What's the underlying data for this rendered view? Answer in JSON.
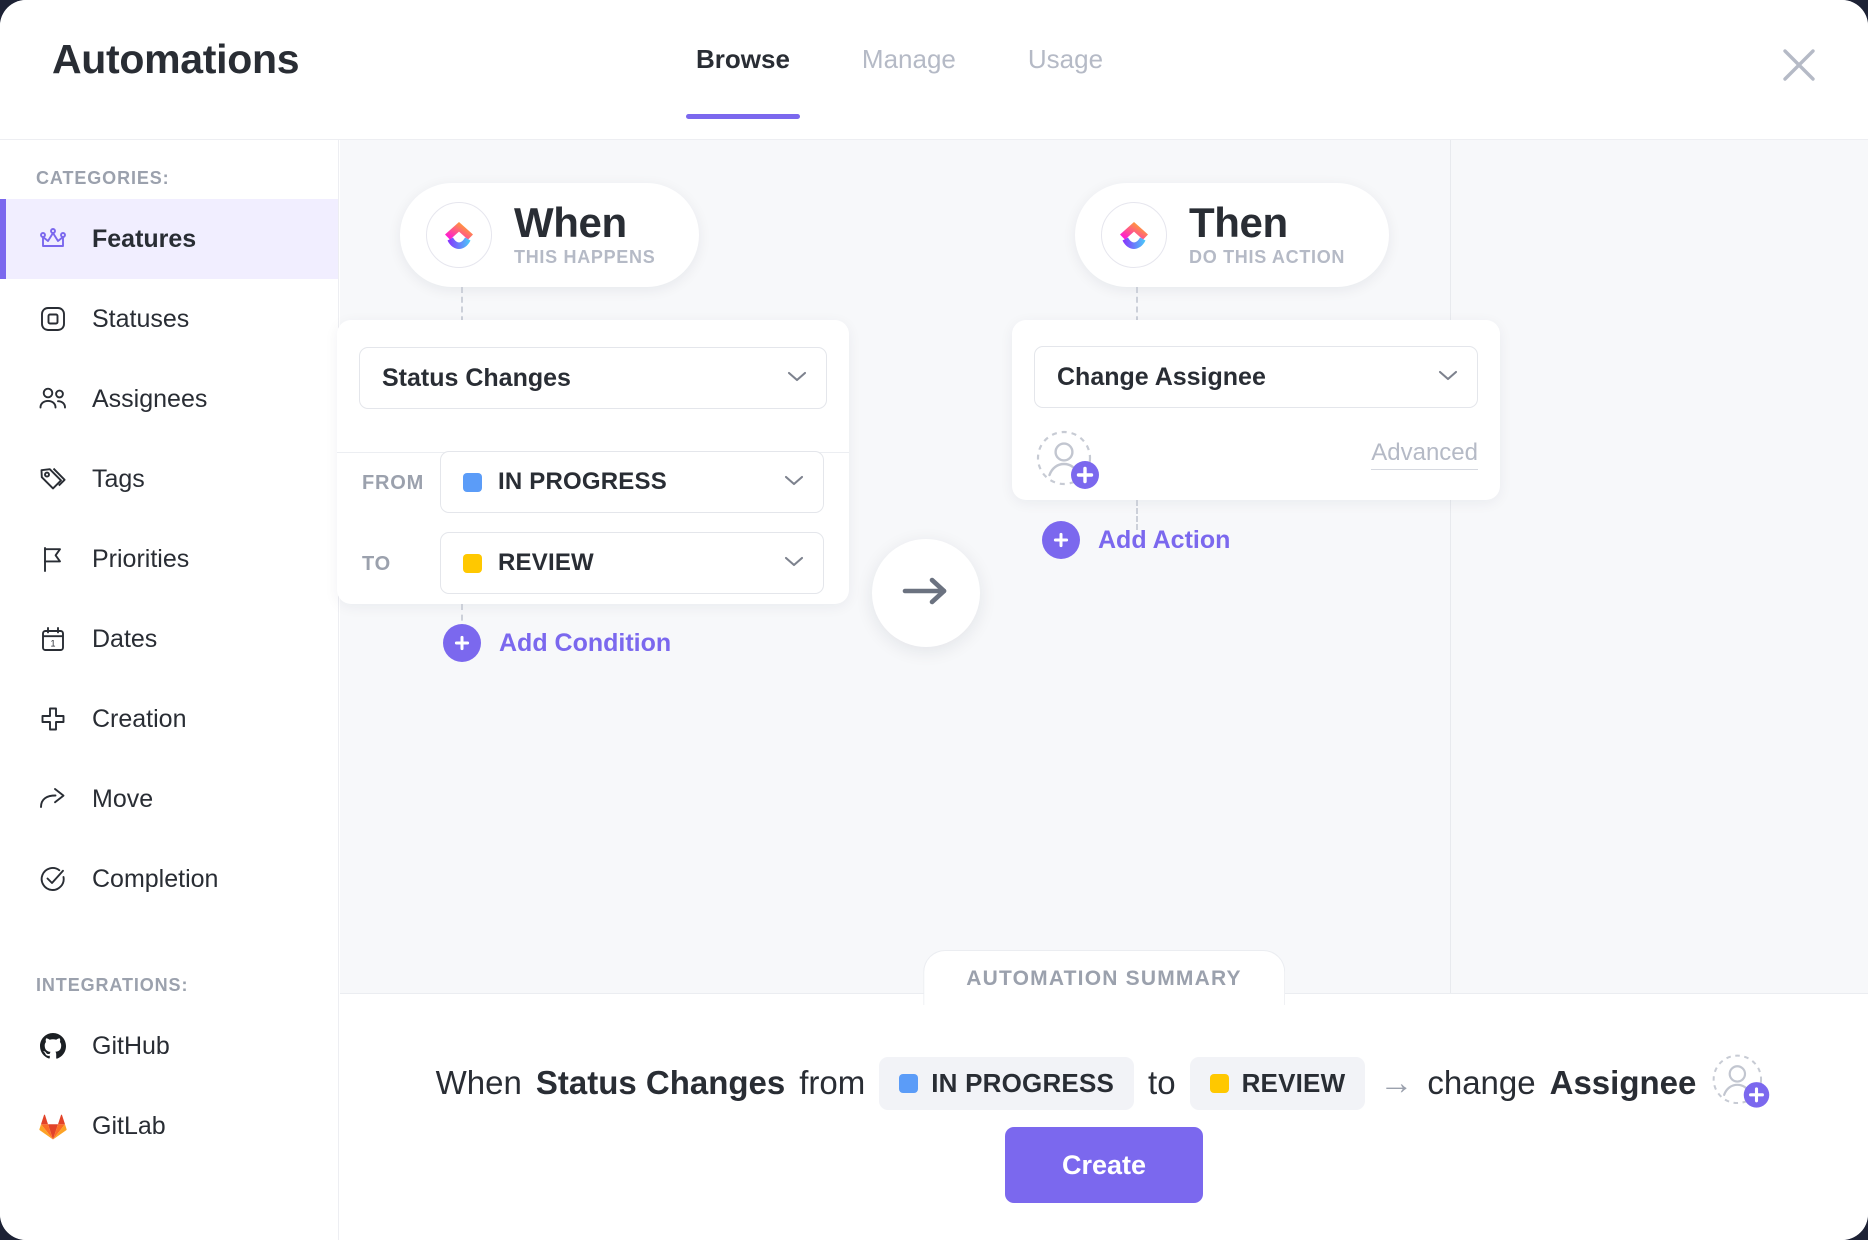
{
  "header": {
    "title": "Automations",
    "tabs": [
      {
        "label": "Browse",
        "active": true
      },
      {
        "label": "Manage",
        "active": false
      },
      {
        "label": "Usage",
        "active": false
      }
    ],
    "close_icon": "close-icon"
  },
  "sidebar": {
    "categories_caption": "CATEGORIES:",
    "integrations_caption": "INTEGRATIONS:",
    "items": [
      {
        "label": "Features",
        "icon": "crown-icon",
        "active": true
      },
      {
        "label": "Statuses",
        "icon": "square-icon",
        "active": false
      },
      {
        "label": "Assignees",
        "icon": "people-icon",
        "active": false
      },
      {
        "label": "Tags",
        "icon": "tag-icon",
        "active": false
      },
      {
        "label": "Priorities",
        "icon": "flag-icon",
        "active": false
      },
      {
        "label": "Dates",
        "icon": "calendar-icon",
        "active": false
      },
      {
        "label": "Creation",
        "icon": "plus-icon",
        "active": false
      },
      {
        "label": "Move",
        "icon": "share-arrow-icon",
        "active": false
      },
      {
        "label": "Completion",
        "icon": "check-circle-icon",
        "active": false
      }
    ],
    "integrations": [
      {
        "label": "GitHub",
        "icon": "github-icon"
      },
      {
        "label": "GitLab",
        "icon": "gitlab-icon"
      }
    ]
  },
  "trigger": {
    "pill_title": "When",
    "pill_subtitle": "THIS HAPPENS",
    "logo_icon": "clickup-logo-icon",
    "trigger_value": "Status Changes",
    "from_label": "FROM",
    "from_value": "IN PROGRESS",
    "from_color": "#5b9cf8",
    "to_label": "TO",
    "to_value": "REVIEW",
    "to_color": "#ffc800",
    "add_condition_label": "Add Condition"
  },
  "flow": {
    "arrow_icon": "arrow-right-icon"
  },
  "action": {
    "pill_title": "Then",
    "pill_subtitle": "DO THIS ACTION",
    "logo_icon": "clickup-logo-icon",
    "action_value": "Change Assignee",
    "assignee_icon": "add-person-icon",
    "advanced_label": "Advanced",
    "add_action_label": "Add Action"
  },
  "summary": {
    "tab_label": "AUTOMATION SUMMARY",
    "word_when": "When",
    "trigger_name": "Status Changes",
    "word_from": "from",
    "from_value": "IN PROGRESS",
    "from_color": "#5b9cf8",
    "word_to": "to",
    "to_value": "REVIEW",
    "to_color": "#ffc800",
    "arrow": "→",
    "word_change": "change",
    "action_name": "Assignee",
    "assignee_icon": "add-person-icon",
    "create_label": "Create"
  },
  "colors": {
    "accent": "#7b68ee",
    "text": "#292d34",
    "muted": "#b5bac6",
    "canvas": "#f7f8fa"
  }
}
